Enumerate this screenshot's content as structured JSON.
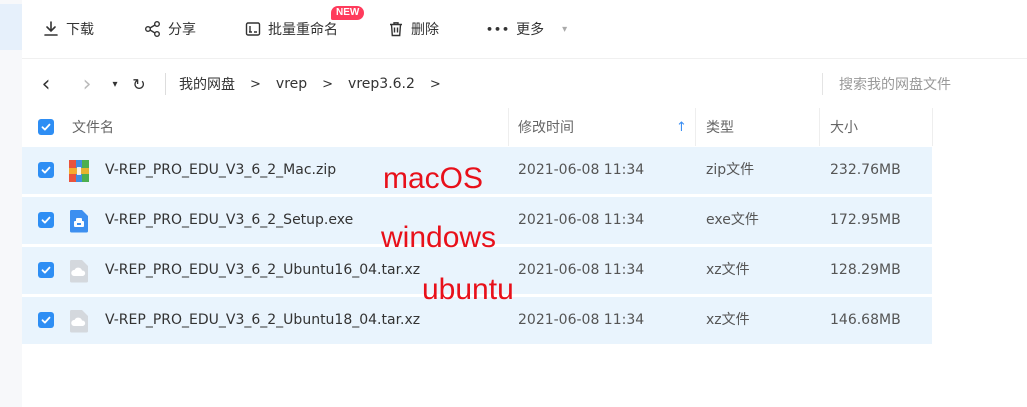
{
  "toolbar": {
    "download_label": "下载",
    "share_label": "分享",
    "rename_label": "批量重命名",
    "rename_badge": "NEW",
    "delete_label": "删除",
    "more_label": "更多",
    "more_glyph": "•••",
    "caret": "▾"
  },
  "nav": {
    "back": "‹",
    "forward": "›",
    "dropdown": "▾",
    "refresh": "↻",
    "breadcrumbs": [
      "我的网盘",
      "vrep",
      "vrep3.6.2"
    ],
    "separator": ">",
    "search_placeholder": "搜索我的网盘文件"
  },
  "table": {
    "headers": {
      "name": "文件名",
      "modified": "修改时间",
      "type": "类型",
      "size": "大小"
    },
    "sort_indicator": "↑",
    "rows": [
      {
        "name": "V-REP_PRO_EDU_V3_6_2_Mac.zip",
        "modified": "2021-06-08 11:34",
        "type": "zip文件",
        "size": "232.76MB",
        "icon": "zip-archive-icon",
        "checked": true
      },
      {
        "name": "V-REP_PRO_EDU_V3_6_2_Setup.exe",
        "modified": "2021-06-08 11:34",
        "type": "exe文件",
        "size": "172.95MB",
        "icon": "exe-installer-icon",
        "checked": true
      },
      {
        "name": "V-REP_PRO_EDU_V3_6_2_Ubuntu16_04.tar.xz",
        "modified": "2021-06-08 11:34",
        "type": "xz文件",
        "size": "128.29MB",
        "icon": "generic-file-icon",
        "checked": true
      },
      {
        "name": "V-REP_PRO_EDU_V3_6_2_Ubuntu18_04.tar.xz",
        "modified": "2021-06-08 11:34",
        "type": "xz文件",
        "size": "146.68MB",
        "icon": "generic-file-icon",
        "checked": true
      }
    ]
  },
  "annotations": {
    "mac": "macOS",
    "windows": "windows",
    "ubuntu": "ubuntu"
  },
  "colors": {
    "accent": "#2e8ef4",
    "row_selected": "#e9f4fd",
    "annotation": "#e8101a",
    "badge": "#ff3b5c"
  }
}
